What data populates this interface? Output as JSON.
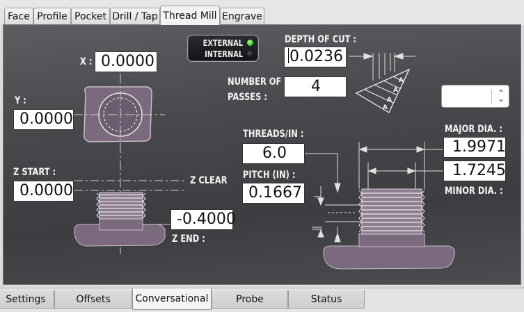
{
  "top_tabs": [
    "Face",
    "Profile",
    "Pocket",
    "Drill / Tap",
    "Thread Mill",
    "Engrave"
  ],
  "active_top_tab": "Thread Mill",
  "toggle": {
    "external_label": "EXTERNAL",
    "internal_label": "INTERNAL",
    "external_on": true
  },
  "fields": {
    "x": {
      "label": "X :",
      "value": "0.0000"
    },
    "y": {
      "label": "Y :",
      "value": "0.0000"
    },
    "z_start": {
      "label": "Z START :",
      "value": "0.0000"
    },
    "z_clear": {
      "label": "Z CLEAR"
    },
    "z_end": {
      "label": "Z END :",
      "value": "-0.4000"
    },
    "depth_of_cut": {
      "label": "DEPTH OF CUT :",
      "value": "0.0236"
    },
    "passes": {
      "label_line1": "NUMBER OF",
      "label_line2": "PASSES :",
      "value": "4"
    },
    "threads_in": {
      "label": "THREADS/IN :",
      "value": "6.0"
    },
    "pitch": {
      "label": "PITCH (IN) :",
      "value": "0.1667"
    },
    "major_dia": {
      "label": "MAJOR DIA. :",
      "value": "1.9971"
    },
    "minor_dia": {
      "label": "MINOR DIA. :",
      "value": "1.7245"
    }
  },
  "triangle_marks": [
    "A",
    "A",
    "A",
    "A"
  ],
  "dropdown": {
    "value": ""
  },
  "bottom_tabs": [
    "Settings",
    "Offsets",
    "Conversational",
    "Probe",
    "Status"
  ],
  "active_bottom_tab": "Conversational",
  "colors": {
    "panel_bg": "#45474b",
    "part_fill": "#7b6a7e",
    "led_green": "#3ddc2a",
    "led_off": "#222222"
  }
}
